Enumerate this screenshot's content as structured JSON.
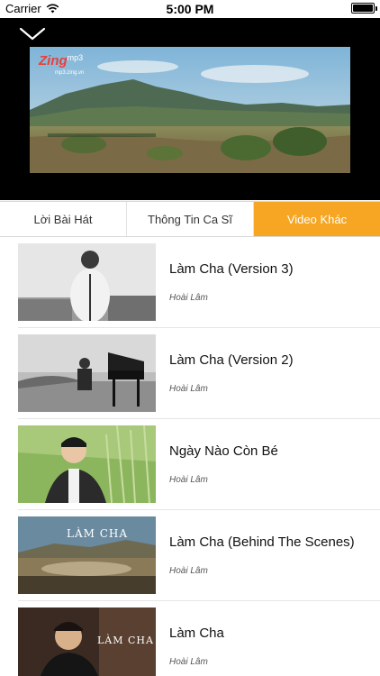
{
  "status_bar": {
    "carrier": "Carrier",
    "time": "5:00 PM"
  },
  "player": {
    "logo_main": "Zing",
    "logo_sub": "mp3",
    "logo_url": "mp3.zing.vn"
  },
  "tabs": [
    {
      "label": "Lời Bài Hát",
      "active": false
    },
    {
      "label": "Thông Tin Ca Sĩ",
      "active": false
    },
    {
      "label": "Video Khác",
      "active": true
    }
  ],
  "videos": [
    {
      "title": "Làm Cha (Version 3)",
      "artist": "Hoài Lâm"
    },
    {
      "title": "Làm Cha (Version 2)",
      "artist": "Hoài Lâm"
    },
    {
      "title": "Ngày Nào Còn Bé",
      "artist": "Hoài Lâm"
    },
    {
      "title": "Làm Cha (Behind The Scenes)",
      "artist": "Hoài Lâm",
      "thumb_caption": "LÀM CHA"
    },
    {
      "title": "Làm Cha",
      "artist": "Hoài Lâm",
      "thumb_caption": "LÀM CHA"
    }
  ],
  "colors": {
    "active_tab": "#f6a623",
    "player_bg": "#000000"
  }
}
